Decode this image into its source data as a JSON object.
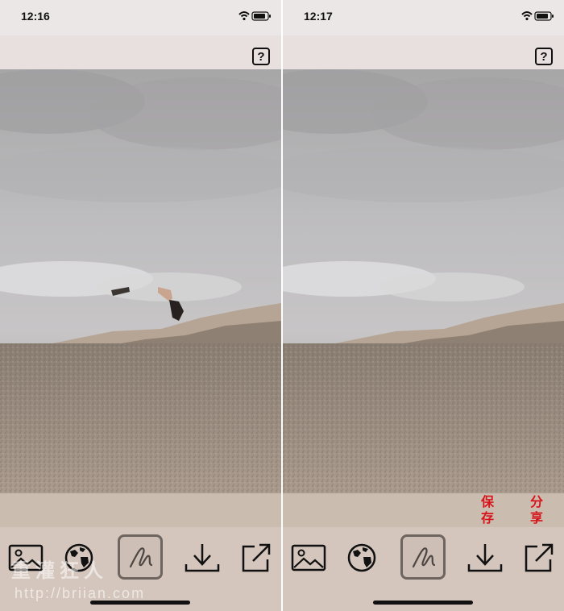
{
  "screens": [
    {
      "time": "12:16",
      "help_label": "?",
      "person_visible": true,
      "tools": [
        {
          "name": "photo-library",
          "icon": "image-icon"
        },
        {
          "name": "globe",
          "icon": "globe-icon"
        },
        {
          "name": "draw-erase",
          "icon": "scribble-icon",
          "selected": true
        },
        {
          "name": "save",
          "icon": "download-icon"
        },
        {
          "name": "share",
          "icon": "share-icon"
        }
      ]
    },
    {
      "time": "12:17",
      "help_label": "?",
      "person_visible": false,
      "tools": [
        {
          "name": "photo-library",
          "icon": "image-icon"
        },
        {
          "name": "globe",
          "icon": "globe-icon"
        },
        {
          "name": "draw-erase",
          "icon": "scribble-icon",
          "selected": true
        },
        {
          "name": "save",
          "icon": "download-icon"
        },
        {
          "name": "share",
          "icon": "share-icon"
        }
      ]
    }
  ],
  "annotations": {
    "save_label": "保存",
    "share_label": "分享"
  },
  "watermark": {
    "text": "重灌狂人",
    "url": "http://briian.com"
  },
  "colors": {
    "status_bg": "#ece7e7",
    "toolbar_bg": "#d4c6bc",
    "callout_red": "#d8141b"
  }
}
